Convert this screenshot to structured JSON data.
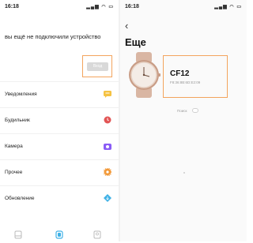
{
  "left": {
    "status": {
      "time": "16:18",
      "icons": "signal-wifi-battery"
    },
    "message": "вы ещё не подключили устройство",
    "connect_button": "Вход",
    "items": [
      {
        "label": "Уведомления",
        "icon": "message-icon",
        "color": "#f5c242"
      },
      {
        "label": "Будильник",
        "icon": "alarm-icon",
        "color": "#e25555"
      },
      {
        "label": "Камера",
        "icon": "camera-icon",
        "color": "#8a5cf6"
      },
      {
        "label": "Прочее",
        "icon": "gear-icon",
        "color": "#f29a3a"
      },
      {
        "label": "Обновление",
        "icon": "update-icon",
        "color": "#3fb1e6"
      }
    ],
    "nav": [
      "home-icon",
      "device-icon",
      "profile-icon"
    ],
    "nav_active_color": "#3fb1e6"
  },
  "right": {
    "status": {
      "time": "16:18",
      "icons": "signal-wifi-battery"
    },
    "title": "Еще",
    "device_name": "CF12",
    "device_mac": "F8:36:8B:6D:E2:09",
    "search_label": "Поиск"
  },
  "colors": {
    "highlight": "#f3a45d",
    "watch": "#d9b6a3"
  }
}
